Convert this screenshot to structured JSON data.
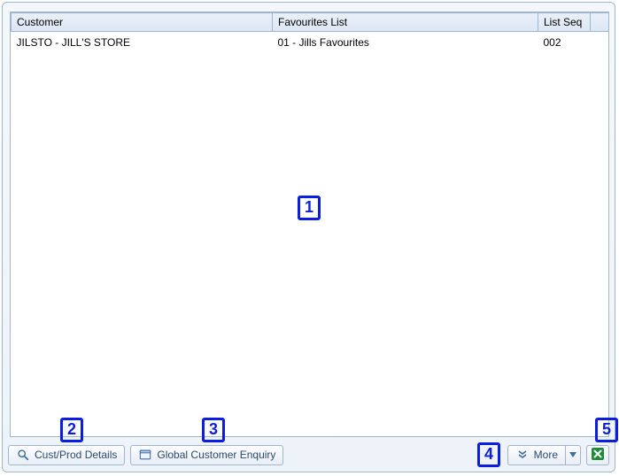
{
  "table": {
    "headers": {
      "customer": "Customer",
      "favourites": "Favourites List",
      "listseq": "List Seq"
    },
    "rows": [
      {
        "customer": "JILSTO - JILL'S STORE",
        "favourites": "01 - Jills Favourites",
        "listseq": "002"
      }
    ]
  },
  "toolbar": {
    "cust_prod_details": "Cust/Prod Details",
    "global_customer_enquiry": "Global Customer Enquiry",
    "more": "More"
  },
  "annotations": {
    "a1": "1",
    "a2": "2",
    "a3": "3",
    "a4": "4",
    "a5": "5"
  }
}
